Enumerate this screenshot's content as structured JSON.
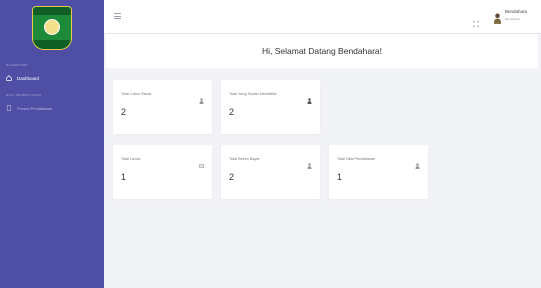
{
  "sidebar": {
    "logo_alt": "SMK Salafiyah",
    "section_main": "DASHBOARD",
    "items": [
      {
        "label": "Dashboard",
        "icon": "home-icon",
        "active": true
      }
    ],
    "section_data": "DATA PENDAFTARAN",
    "items2": [
      {
        "label": "Proses Pendaftaran",
        "icon": "document-icon"
      }
    ]
  },
  "topbar": {
    "menu_icon": "hamburger-icon",
    "fullscreen_icon": "fullscreen-icon",
    "user_name": "Bendahara",
    "user_role": "Bendahara"
  },
  "banner": {
    "text": "Hi, Selamat Datang Bendahara!"
  },
  "cards_row1": [
    {
      "label": "Total Calon Siswa",
      "value": "2",
      "icon": "user-icon"
    },
    {
      "label": "Total Yang Sudah Mendaftar",
      "value": "2",
      "icon": "user-icon"
    }
  ],
  "cards_row2": [
    {
      "label": "Total Lunas",
      "value": "1",
      "icon": "money-icon"
    },
    {
      "label": "Total Belum Bayar",
      "value": "2",
      "icon": "user-icon"
    },
    {
      "label": "Total Nilai Pendaftaran",
      "value": "1",
      "icon": "user-icon"
    }
  ],
  "colors": {
    "sidebar": "#4e4fa4",
    "background": "#f2f3f7"
  }
}
